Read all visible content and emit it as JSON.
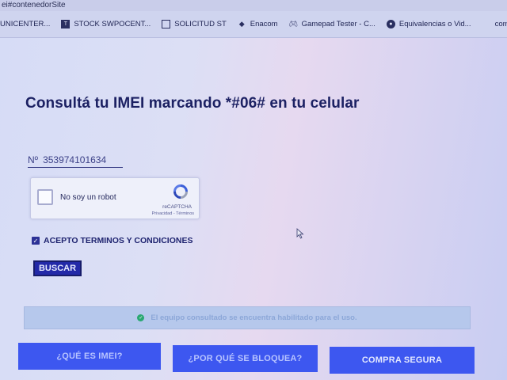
{
  "browser": {
    "url_fragment": "ei#contenedorSite",
    "bookmarks": [
      {
        "label": "UNICENTER...",
        "icon": "folder-icon"
      },
      {
        "label": "STOCK SWPOCENT...",
        "icon": "doc-icon"
      },
      {
        "label": "SOLICITUD ST",
        "icon": "form-icon"
      },
      {
        "label": "Enacom",
        "icon": "drop-icon"
      },
      {
        "label": "Gamepad Tester - C...",
        "icon": "gamepad-icon"
      },
      {
        "label": "Equivalencias o Vid...",
        "icon": "globe-icon"
      },
      {
        "label": "como reconoce",
        "icon": "apple-icon"
      }
    ]
  },
  "page": {
    "title": "Consultá tu IMEI marcando *#06# en tu celular",
    "imei_prefix": "Nº",
    "imei_value": "353974101634"
  },
  "captcha": {
    "label": "No soy un robot",
    "brand": "reCAPTCHA",
    "links": "Privacidad - Términos"
  },
  "terms": {
    "checked": true,
    "label": "ACEPTO TERMINOS Y CONDICIONES"
  },
  "search_button": "BUSCAR",
  "status": {
    "message": "El equipo consultado se encuentra habilitado para el uso.",
    "color": "#2aa872"
  },
  "nav": {
    "what_is_imei": "¿QUÉ ES IMEI?",
    "why_blocked": "¿POR QUÉ SE BLOQUEA?",
    "safe_purchase": "COMPRA SEGURA"
  },
  "colors": {
    "accent": "#2329a8",
    "nav_button": "#3d57f0",
    "title": "#1c2163"
  }
}
